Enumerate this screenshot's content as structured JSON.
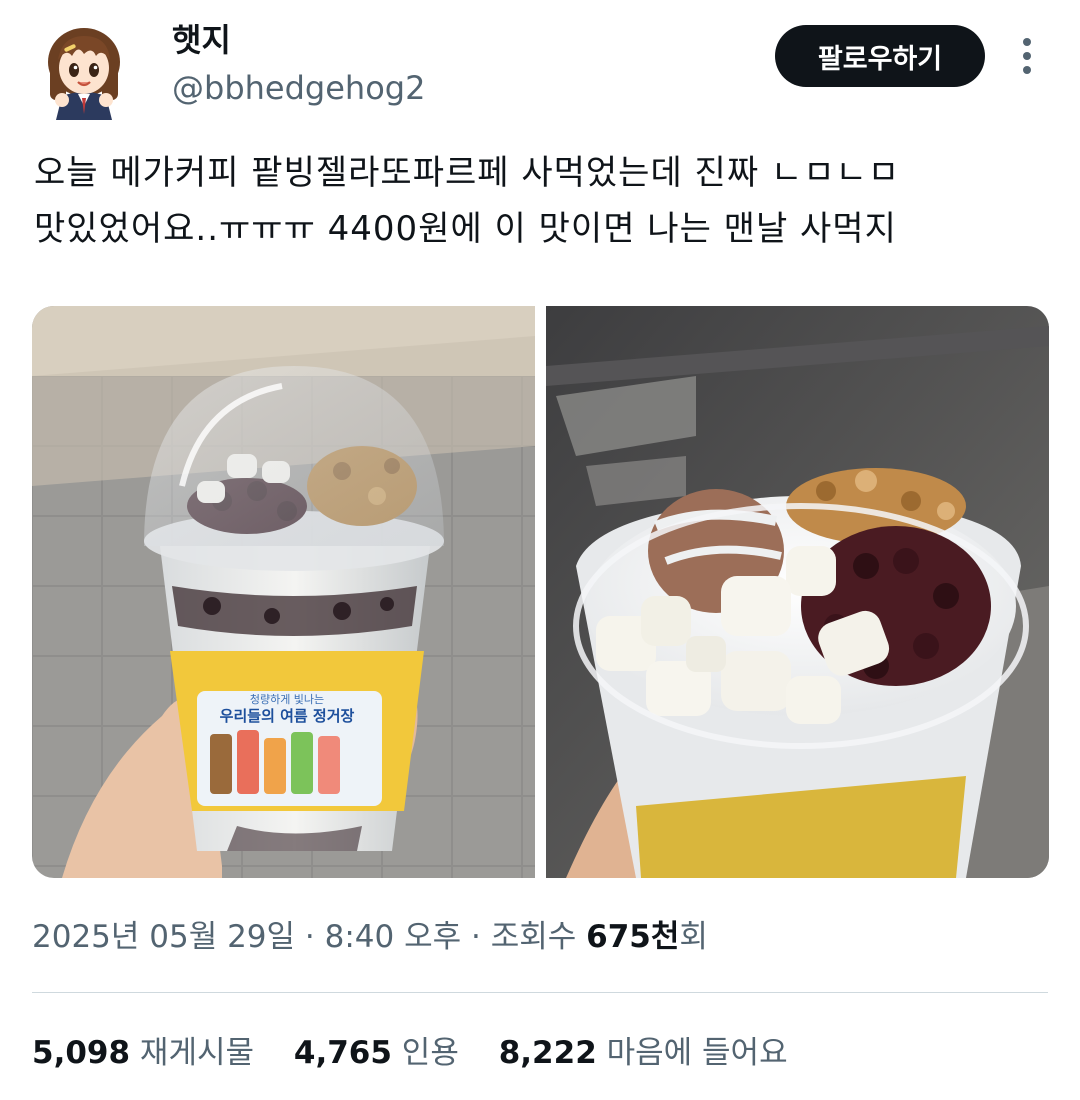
{
  "author": {
    "name": "햇지",
    "handle": "@bbhedgehog2"
  },
  "follow_label": "팔로우하기",
  "tweet": {
    "line1": "오늘 메가커피 팥빙젤라또파르페 사먹었는데 진짜 ㄴㅁㄴㅁ",
    "line2": "맛있었어요..ㅠㅠㅠ 4400원에 이 맛이면 나는 맨날 사먹지"
  },
  "cup_sleeve": {
    "tagline": "청량하게 빛나는",
    "headline": "우리들의 여름 정거장"
  },
  "meta": {
    "date": "2025년 05월 29일",
    "sep1": " · ",
    "time": "8:40 오후",
    "sep2": " · ",
    "views_label": "조회수 ",
    "views_value": "675천",
    "views_suffix": "회"
  },
  "stats": {
    "retweets_count": "5,098",
    "retweets_label": "재게시물",
    "quotes_count": "4,765",
    "quotes_label": "인용",
    "likes_count": "8,222",
    "likes_label": "마음에 들어요"
  },
  "colors": {
    "text_primary": "#0f1419",
    "text_secondary": "#536471",
    "follow_bg": "#0f1419",
    "divider": "#cfd9de"
  },
  "icons": {
    "more": "more-vertical-icon",
    "avatar": "anime-girl-avatar"
  }
}
